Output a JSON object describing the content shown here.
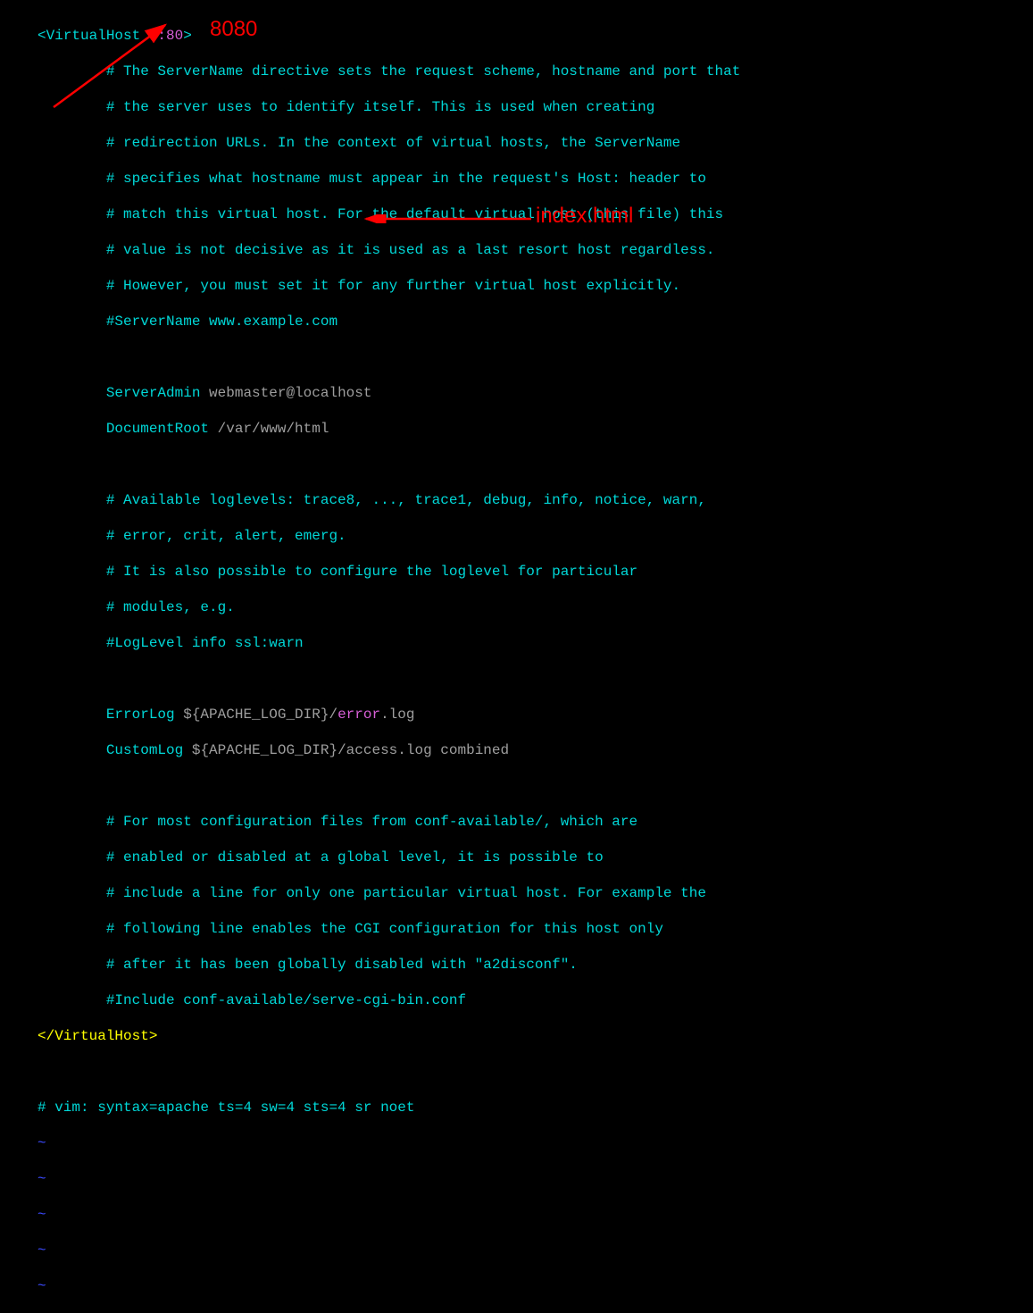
{
  "annotations": {
    "port": "8080",
    "index": "index.html"
  },
  "lines": {
    "l1_open": "<",
    "l1_tag": "VirtualHost ",
    "l1_port": "*:80",
    "l1_close": ">",
    "l2": "        # The ServerName directive sets the request scheme, hostname and port that",
    "l3": "        # the server uses to identify itself. This is used when creating",
    "l4": "        # redirection URLs. In the context of virtual hosts, the ServerName",
    "l5": "        # specifies what hostname must appear in the request's Host: header to",
    "l6": "        # match this virtual host. For the default virtual host (this file) this",
    "l7": "        # value is not decisive as it is used as a last resort host regardless.",
    "l8": "        # However, you must set it for any further virtual host explicitly.",
    "l9": "        #ServerName www.example.com",
    "l10_dir": "        ServerAdmin",
    "l10_val": " webmaster@localhost",
    "l11_dir": "        DocumentRoot",
    "l11_val": " /var/www/html",
    "l12": "        # Available loglevels: trace8, ..., trace1, debug, info, notice, warn,",
    "l13": "        # error, crit, alert, emerg.",
    "l14": "        # It is also possible to configure the loglevel for particular",
    "l15": "        # modules, e.g.",
    "l16": "        #LogLevel info ssl:warn",
    "l17_dir": "        ErrorLog",
    "l17_var": " ${APACHE_LOG_DIR}/",
    "l17_err": "error",
    "l17_ext": ".log",
    "l18_dir": "        CustomLog",
    "l18_val": " ${APACHE_LOG_DIR}/access.log combined",
    "l19": "        # For most configuration files from conf-available/, which are",
    "l20": "        # enabled or disabled at a global level, it is possible to",
    "l21": "        # include a line for only one particular virtual host. For example the",
    "l22": "        # following line enables the CGI configuration for this host only",
    "l23": "        # after it has been globally disabled with \"a2disconf\".",
    "l24": "        #Include conf-available/serve-cgi-bin.conf",
    "l25": "</VirtualHost>",
    "l26": "# vim: syntax=apache ts=4 sw=4 sts=4 sr noet",
    "tilde": "~"
  }
}
